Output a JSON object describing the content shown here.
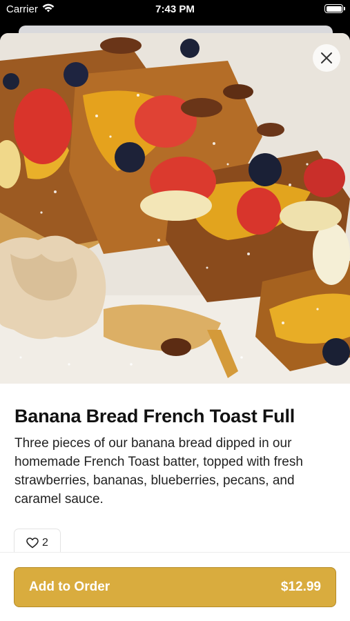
{
  "status_bar": {
    "carrier": "Carrier",
    "time": "7:43 PM",
    "wifi_icon": "wifi-icon",
    "battery_icon": "battery-icon"
  },
  "item": {
    "image_alt": "",
    "title": "Banana Bread French Toast Full",
    "description": "Three pieces of our banana bread dipped in our homemade French Toast batter, topped with fresh strawberries, bananas, blueberries, pecans, and caramel sauce.",
    "likes": "2",
    "like_icon": "heart-outline-icon"
  },
  "close_icon": "close-icon",
  "order": {
    "label": "Add to Order",
    "price": "$12.99"
  },
  "colors": {
    "accent": "#d9ac3e",
    "accent_border": "#b58a26",
    "text": "#111111"
  }
}
